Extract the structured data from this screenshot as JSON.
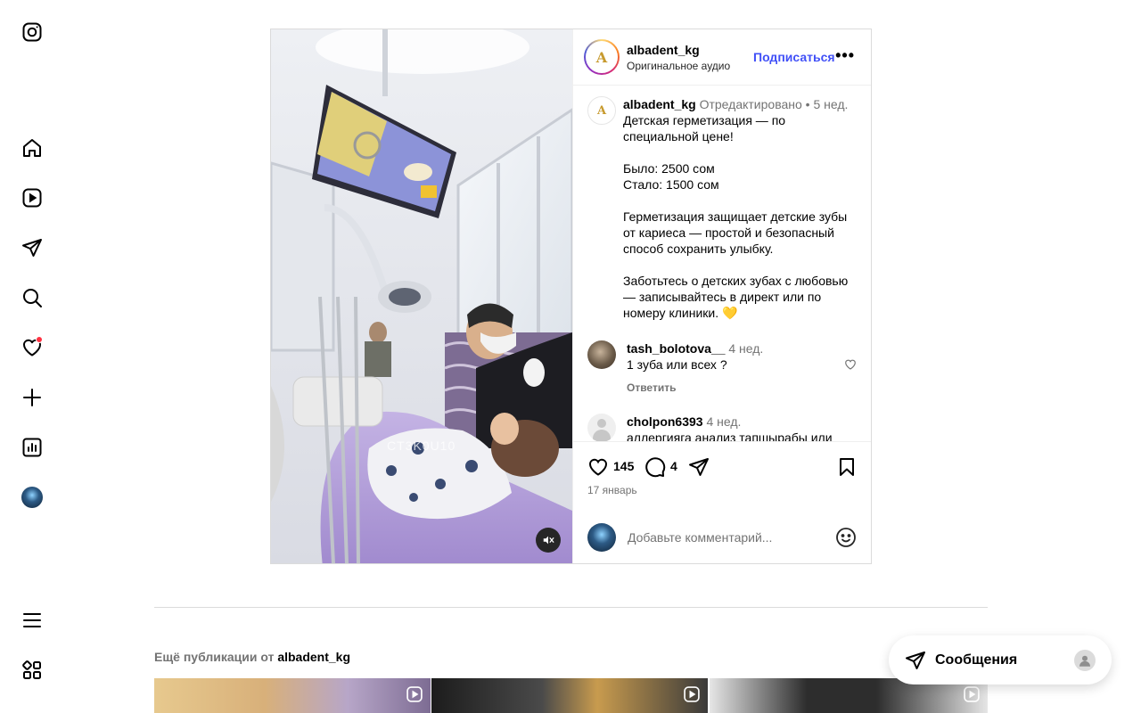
{
  "sidebar": {
    "items": [
      {
        "name": "instagram-logo"
      },
      {
        "name": "home"
      },
      {
        "name": "reels"
      },
      {
        "name": "messages"
      },
      {
        "name": "search"
      },
      {
        "name": "notifications"
      },
      {
        "name": "create"
      },
      {
        "name": "dashboard"
      },
      {
        "name": "profile"
      },
      {
        "name": "more"
      },
      {
        "name": "also-from-meta"
      }
    ]
  },
  "post": {
    "username": "albadent_kg",
    "audio": "Оригинальное аудио",
    "follow_label": "Подписаться",
    "more_label": "•••",
    "watermark": "CT3K0U10",
    "caption": {
      "username": "albadent_kg",
      "edited": "Отредактировано",
      "dot": " • ",
      "time": "5 нед.",
      "text": "Детская герметизация — по специальной цене!\n\nБыло: 2500 сом\nСтало: 1500 сом\n\nГерметизация защищает детские зубы от кариеса — простой и безопасный способ сохранить улыбку.\n\nЗаботьтесь о детских зубах с любовью — записывайтесь в директ или по номеру клиники. 💛"
    },
    "comments": [
      {
        "username": "tash_bolotova__",
        "time": "4 нед.",
        "text": "1 зуба или всех ?",
        "reply": "Ответить"
      },
      {
        "username": "cholpon6393",
        "time": "4 нед.",
        "text": "аллергияга анализ тапшырабы или"
      }
    ],
    "likes": "145",
    "comment_count": "4",
    "date": "17 январь",
    "comment_placeholder": "Добавьте комментарий..."
  },
  "more_section": {
    "prefix": "Ещё публикации от ",
    "username": "albadent_kg"
  },
  "messages_widget": {
    "label": "Сообщения"
  },
  "colors": {
    "accent": "#4150f7",
    "notification": "#ff3040",
    "secondary_text": "#737373",
    "border": "#dbdbdb"
  }
}
